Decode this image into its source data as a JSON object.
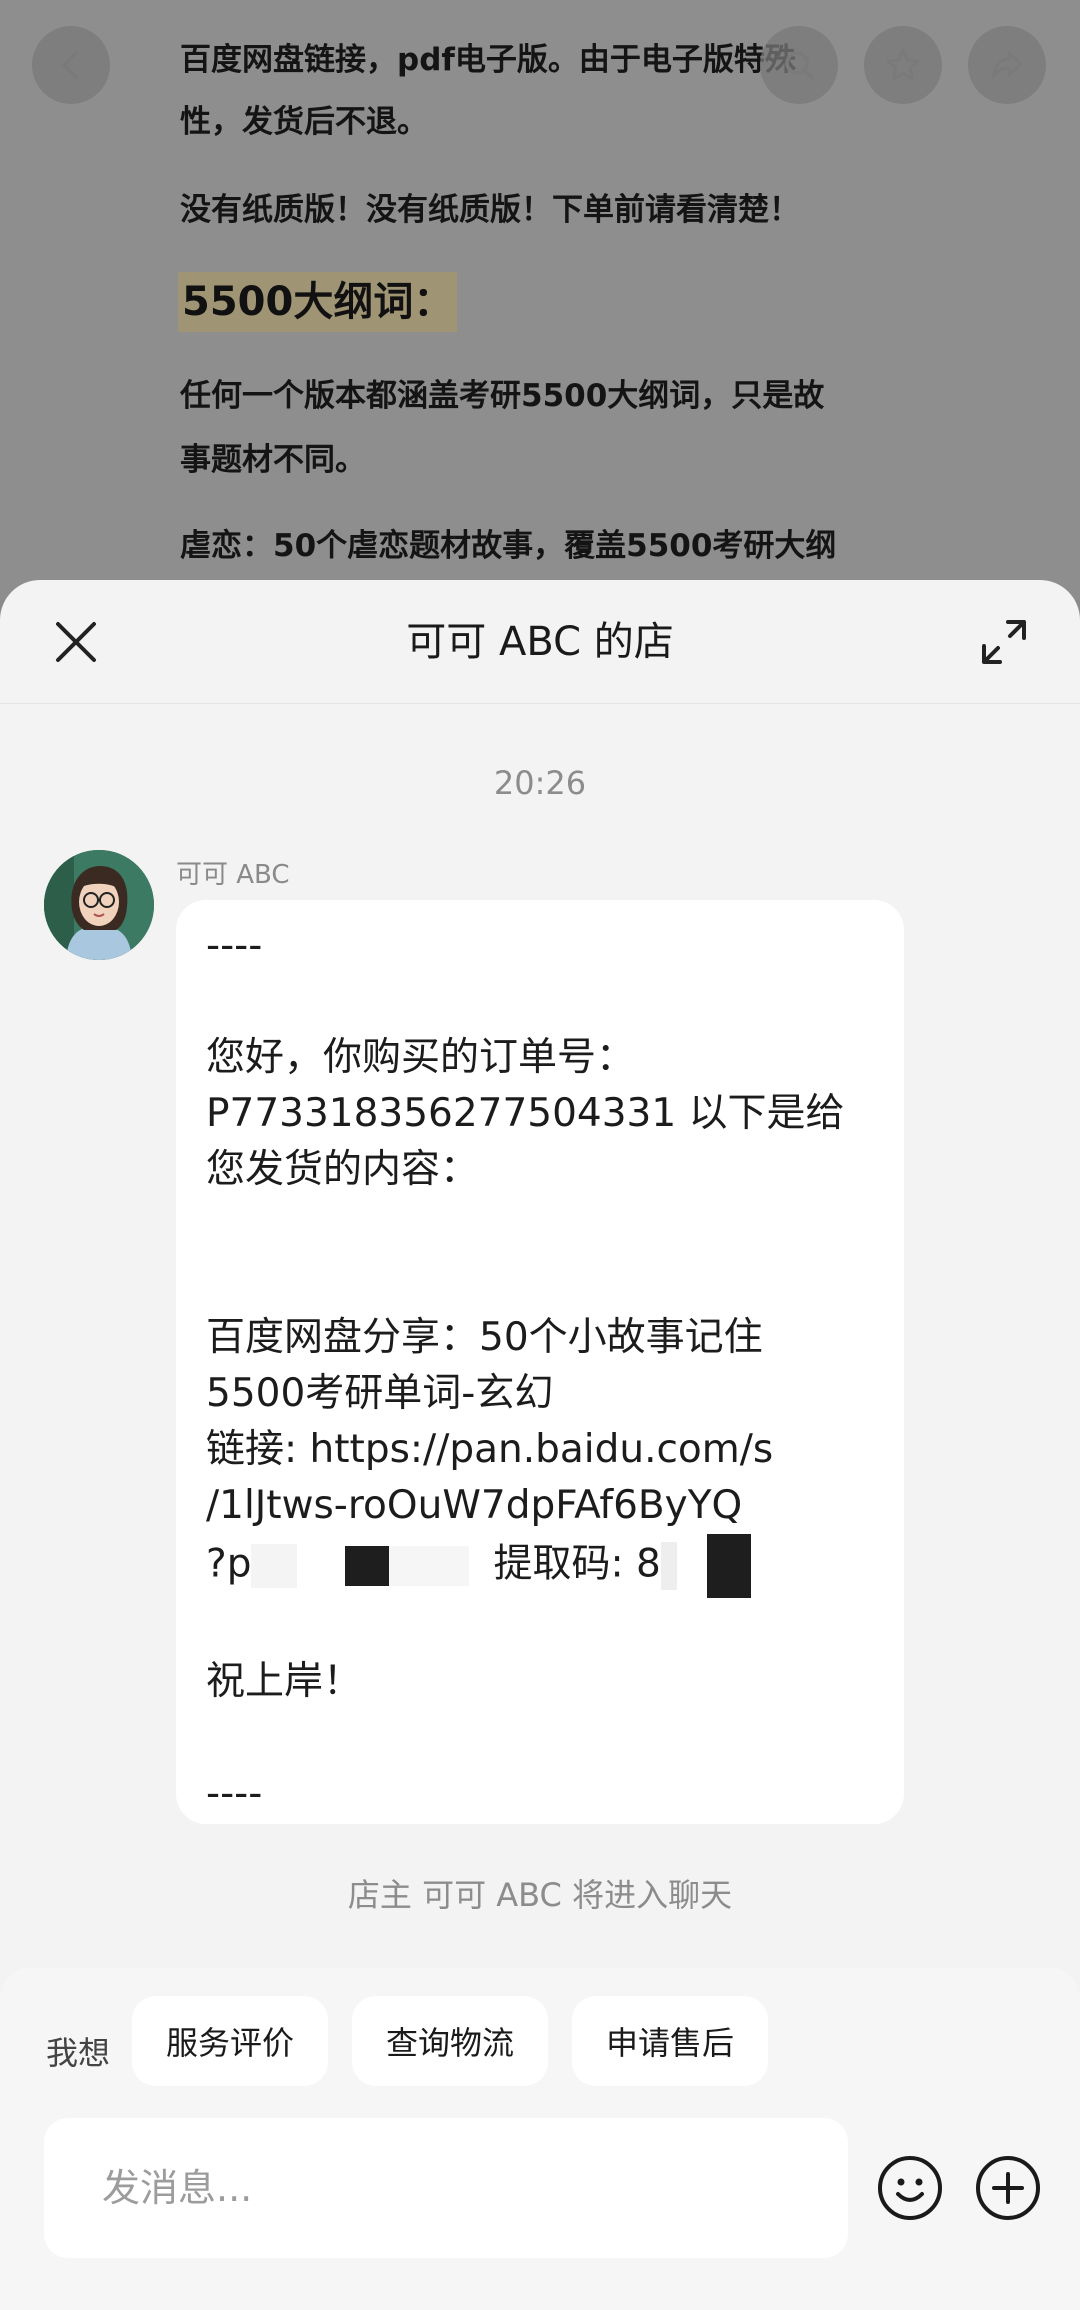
{
  "background": {
    "lines": [
      "百度网盘链接，pdf电子版。由于电子版特殊",
      "性，发货后不退。",
      "没有纸质版！没有纸质版！下单前请看清楚！",
      "5500大纲词：",
      "任何一个版本都涵盖考研5500大纲词，只是故",
      "事题材不同。",
      "虐恋：50个虐恋题材故事，覆盖5500考研大纲"
    ]
  },
  "header": {
    "title": "可可 ABC 的店"
  },
  "chat": {
    "time": "20:26",
    "sender": "可可 ABC",
    "message": {
      "line1": "----",
      "line2": "您好，你购买的订单号：",
      "line3": "P77331835627750433​1 以下是给",
      "line4": "您发货的内容：",
      "line5": "百度网盘分享：50个小故事记住",
      "line6": "5500考研单词-玄幻",
      "line7": "链接: https://pan.baidu.com/s",
      "line8": "/1lJtws-roOuW7dpFAf6ByYQ",
      "line9a": "?p",
      "line9b": "提取码: 8",
      "line10": "祝上岸！",
      "line11": "----"
    },
    "system_note": "店主 可可 ABC 将进入聊天"
  },
  "bottom": {
    "want_label": "我想",
    "chips": [
      "服务评价",
      "查询物流",
      "申请售后"
    ],
    "input_placeholder": "发消息..."
  }
}
